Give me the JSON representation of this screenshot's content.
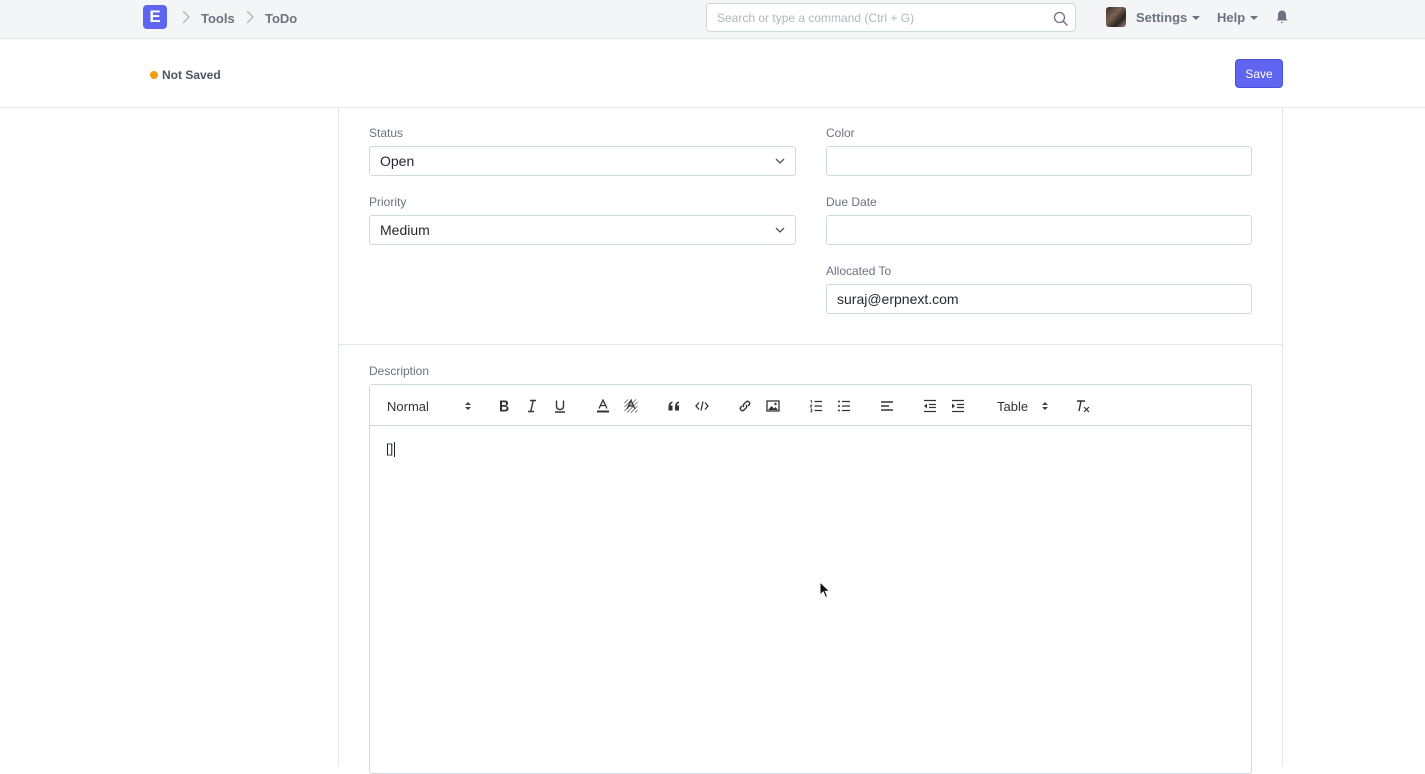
{
  "navbar": {
    "logo": "E",
    "breadcrumbs": [
      "Tools",
      "ToDo"
    ],
    "search_placeholder": "Search or type a command (Ctrl + G)",
    "settings_label": "Settings",
    "help_label": "Help"
  },
  "page_head": {
    "status_indicator": "Not Saved",
    "save_label": "Save"
  },
  "form": {
    "status": {
      "label": "Status",
      "value": "Open"
    },
    "priority": {
      "label": "Priority",
      "value": "Medium"
    },
    "color": {
      "label": "Color",
      "value": ""
    },
    "due_date": {
      "label": "Due Date",
      "value": ""
    },
    "allocated_to": {
      "label": "Allocated To",
      "value": "suraj@erpnext.com"
    },
    "description": {
      "label": "Description",
      "content": "[]",
      "toolbar": {
        "header_select": "Normal",
        "table_select": "Table"
      }
    }
  },
  "colors": {
    "primary": "#5f65f0",
    "not_saved_dot": "#f59e0b"
  },
  "icons": [
    "search-icon",
    "bell-icon",
    "bold-icon",
    "italic-icon",
    "underline-icon",
    "text-color-icon",
    "highlight-icon",
    "blockquote-icon",
    "code-icon",
    "link-icon",
    "image-icon",
    "ordered-list-icon",
    "bullet-list-icon",
    "align-left-icon",
    "outdent-icon",
    "indent-icon",
    "clear-format-icon"
  ]
}
